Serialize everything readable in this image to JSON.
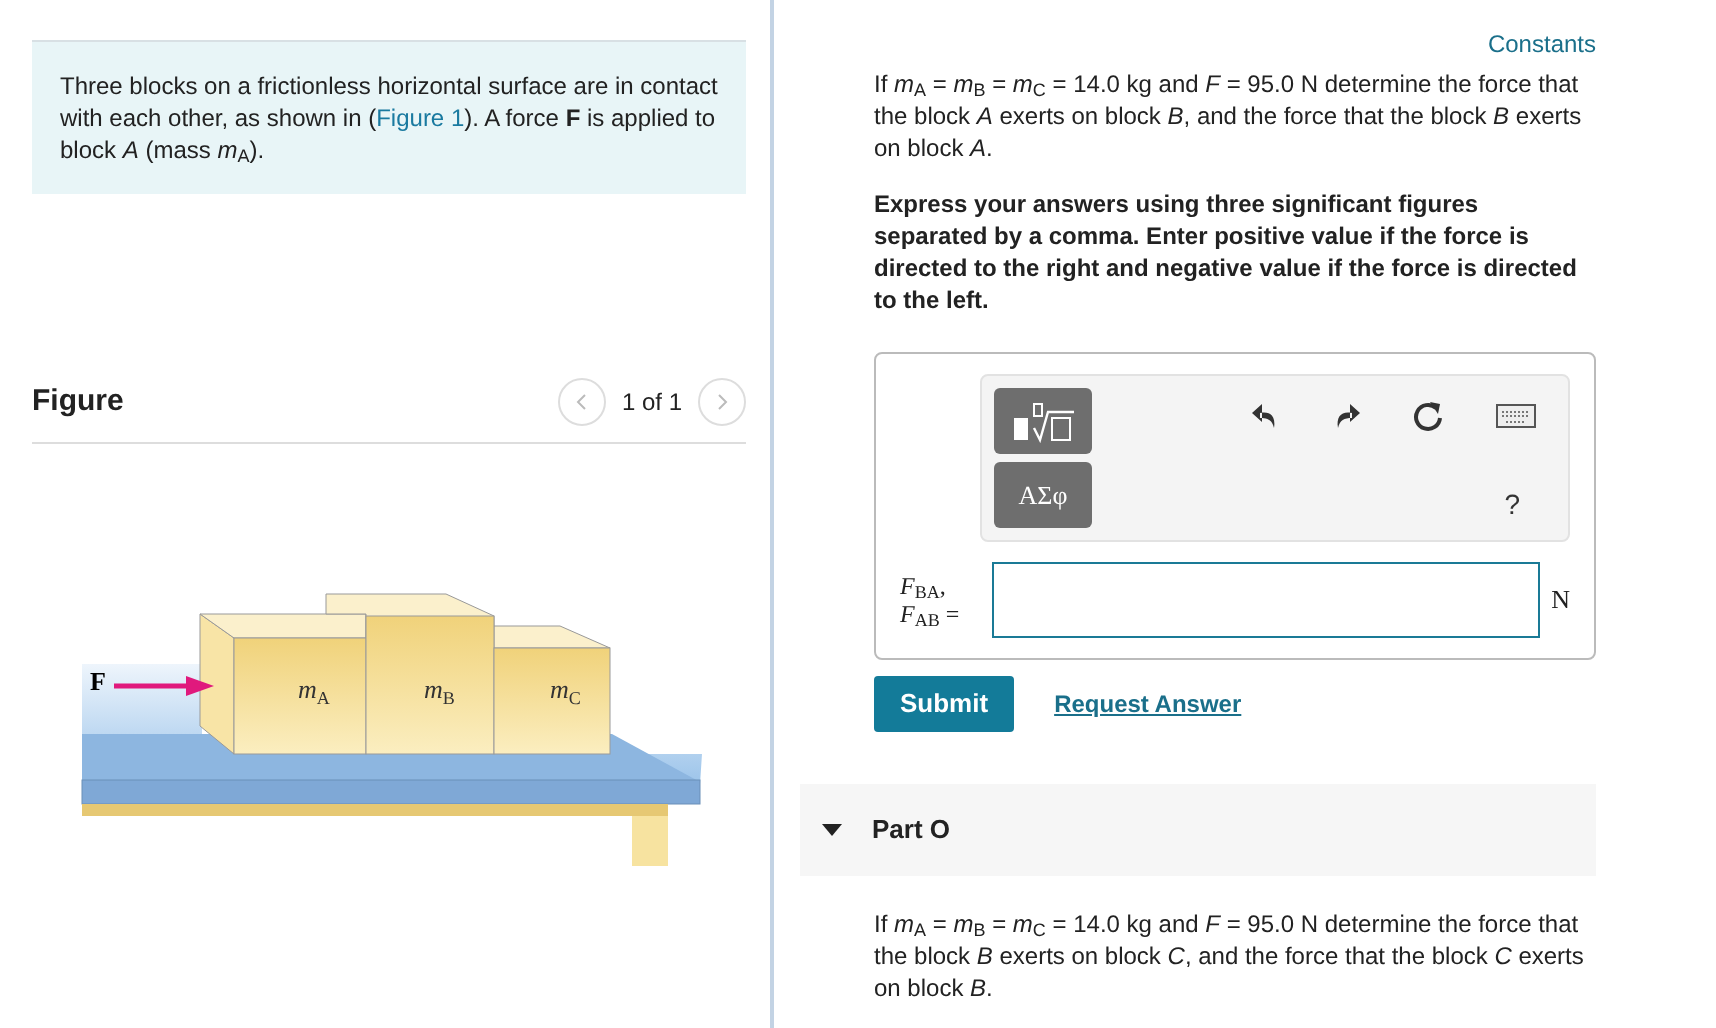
{
  "intro": {
    "before": "Three blocks on a frictionless horizontal surface are in contact with each other, as shown in (",
    "link": "Figure 1",
    "after": "). A force **F** is applied to block *A* (mass *m*$_{A}$)."
  },
  "figure": {
    "title": "Figure",
    "pager": "1 of 1",
    "labels": [
      {
        "kind": "force",
        "text": "F"
      },
      {
        "kind": "mass",
        "text": "m",
        "sub": "A"
      },
      {
        "kind": "mass",
        "text": "m",
        "sub": "B"
      },
      {
        "kind": "mass",
        "text": "m",
        "sub": "C"
      }
    ]
  },
  "constants_link": "Constants",
  "question": "If *m*$_{A}$ = *m*$_{B}$ = *m*$_{C}$ = 14.0 kg and *F* = 95.0 N determine the force that the block *A* exerts on block *B*, and the force that the block *B* exerts on block *A*.",
  "instructions": "Express your answers using three significant figures separated by a comma. Enter positive value if the force is directed to the right and negative value if the force is directed to the left.",
  "toolbar": {
    "greek": "ΑΣφ",
    "help": "?"
  },
  "answer": {
    "label": "*F*$_{BA}$, *F*$_{AB}$ =",
    "unit": "N"
  },
  "submit": "Submit",
  "request": "Request Answer",
  "next_part": {
    "title": "Part O",
    "expanded": true,
    "question": "If *m*$_{A}$ = *m*$_{B}$ = *m*$_{C}$ = 14.0 kg and *F* = 95.0 N determine the force that the block *B* exerts on block *C*, and the force that the block *C* exerts on block *B*."
  }
}
